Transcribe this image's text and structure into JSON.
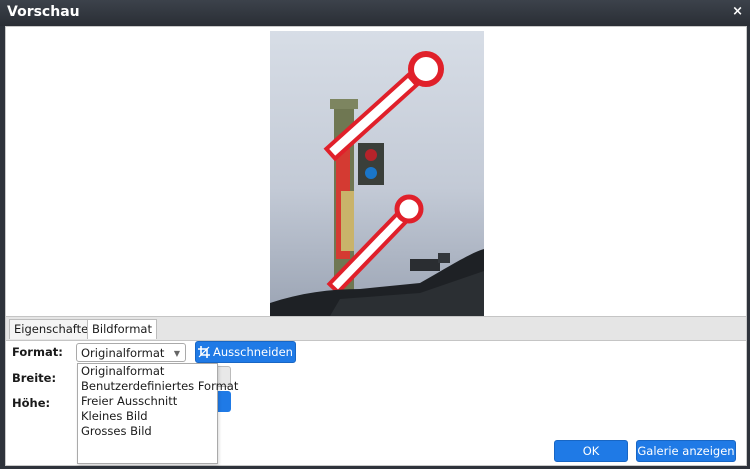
{
  "window": {
    "title": "Vorschau",
    "close_symbol": "×"
  },
  "tabs": [
    {
      "label": "Eigenschaften",
      "active": false
    },
    {
      "label": "Bildformat",
      "active": true
    }
  ],
  "form": {
    "format_label": "Format:",
    "format_value": "Originalformat",
    "crop_button": "Ausschneiden",
    "width_label": "Breite:",
    "height_label": "Höhe:",
    "format_options": [
      "Originalformat",
      "Benutzerdefiniertes Format",
      "Freier Ausschnitt",
      "Kleines Bild",
      "Grosses Bild"
    ]
  },
  "buttons": {
    "ok": "OK",
    "gallery": "Galerie anzeigen"
  },
  "colors": {
    "accent": "#1f7ae6",
    "titlebar": "#2e333b",
    "signal_red": "#e0202a"
  }
}
